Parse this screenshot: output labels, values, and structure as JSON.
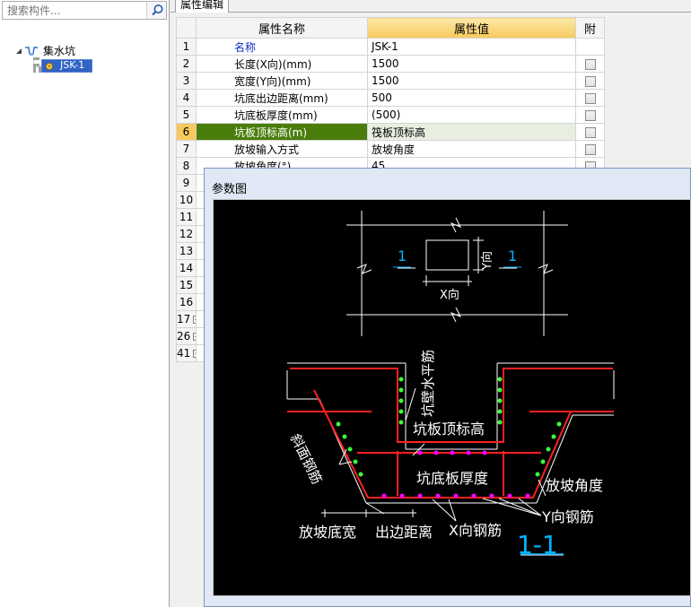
{
  "search": {
    "placeholder": "搜索构件..."
  },
  "tree": {
    "root_label": "集水坑",
    "child_label": "JSK-1"
  },
  "tabs": {
    "property_edit": "属性编辑"
  },
  "grid": {
    "header": {
      "num": "",
      "name": "属性名称",
      "value": "属性值",
      "attach": "附"
    },
    "rows": [
      {
        "num": "1",
        "name": "名称",
        "value": "JSK-1",
        "checkbox": false
      },
      {
        "num": "2",
        "name": "长度(X向)(mm)",
        "value": "1500",
        "checkbox": true
      },
      {
        "num": "3",
        "name": "宽度(Y向)(mm)",
        "value": "1500",
        "checkbox": true
      },
      {
        "num": "4",
        "name": "坑底出边距离(mm)",
        "value": "500",
        "checkbox": true
      },
      {
        "num": "5",
        "name": "坑底板厚度(mm)",
        "value": "(500)",
        "checkbox": true
      },
      {
        "num": "6",
        "name": "坑板顶标高(m)",
        "value": "筏板顶标高",
        "checkbox": true
      },
      {
        "num": "7",
        "name": "放坡输入方式",
        "value": "放坡角度",
        "checkbox": true
      },
      {
        "num": "8",
        "name": "放坡角度(°)",
        "value": "45",
        "checkbox": true
      },
      {
        "num": "9",
        "name": "",
        "value": "",
        "checkbox": false
      },
      {
        "num": "10",
        "name": "",
        "value": "",
        "checkbox": false
      },
      {
        "num": "11",
        "name": "",
        "value": "",
        "checkbox": false
      },
      {
        "num": "12",
        "name": "",
        "value": "",
        "checkbox": false
      },
      {
        "num": "13",
        "name": "",
        "value": "",
        "checkbox": false
      },
      {
        "num": "14",
        "name": "",
        "value": "",
        "checkbox": false
      },
      {
        "num": "15",
        "name": "",
        "value": "",
        "checkbox": false
      },
      {
        "num": "16",
        "name": "",
        "value": "",
        "checkbox": false
      },
      {
        "num": "17",
        "name": "",
        "value": "",
        "checkbox": false,
        "expander": "+"
      },
      {
        "num": "26",
        "name": "",
        "value": "",
        "checkbox": false,
        "expander": "+"
      },
      {
        "num": "41",
        "name": "",
        "value": "",
        "checkbox": false,
        "expander": "+"
      }
    ],
    "selected_row": "6"
  },
  "param_dialog": {
    "title": "参数图",
    "labels": {
      "section_left": "1",
      "section_right": "1",
      "y_dir": "Y向",
      "x_dir": "X向",
      "wall_rebar": "坑壁水平筋",
      "slope_rebar": "斜面钢筋",
      "top_elev": "坑板顶标高",
      "bottom_thick": "坑底板厚度",
      "slope_angle": "放坡角度",
      "y_rebar": "Y向钢筋",
      "slope_bottom_width": "放坡底宽",
      "edge_distance": "出边距离",
      "x_rebar": "X向钢筋",
      "section_title": "1-1"
    }
  }
}
